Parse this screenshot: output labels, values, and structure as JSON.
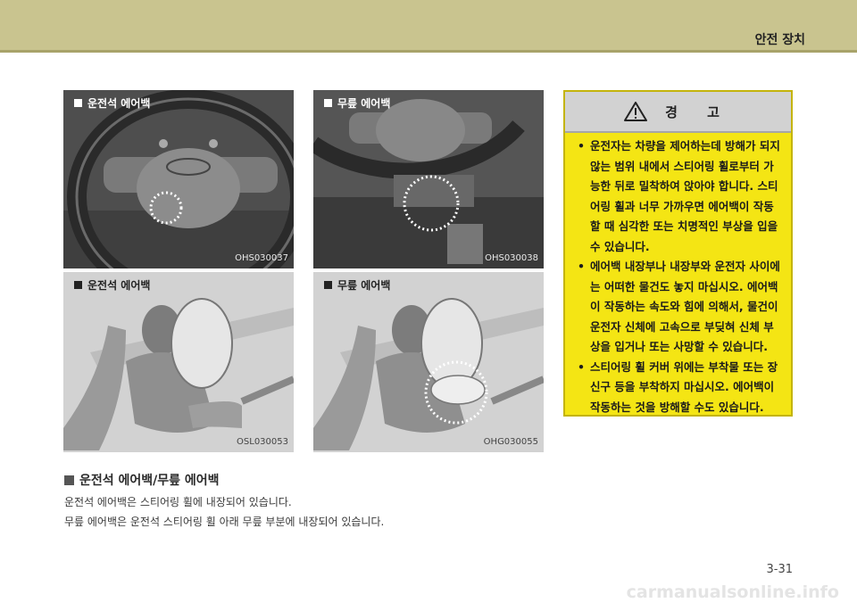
{
  "header": {
    "title": "안전 장치"
  },
  "figures": [
    {
      "caption": "운전석 에어백",
      "code": "OHS030037"
    },
    {
      "caption": "무릎 에어백",
      "code": "OHS030038"
    },
    {
      "caption": "운전석 에어백",
      "code": "OSL030053"
    },
    {
      "caption": "무릎 에어백",
      "code": "OHG030055"
    }
  ],
  "warning": {
    "title": "경 고",
    "items": [
      "운전자는 차량을 제어하는데 방해가 되지 않는 범위 내에서 스티어링 휠로부터 가능한 뒤로 밀착하여 앉아야 합니다. 스티어링 휠과 너무 가까우면 에어백이 작동할 때 심각한 또는 치명적인 부상을 입을 수 있습니다.",
      "에어백 내장부나 내장부와 운전자 사이에는 어떠한 물건도 놓지 마십시오. 에어백이 작동하는 속도와 힘에 의해서, 물건이 운전자 신체에 고속으로 부딪혀 신체 부상을 입거나 또는 사망할 수 있습니다.",
      "스티어링 휠 커버 위에는 부착물 또는 장신구 등을 부착하지 마십시오. 에어백이 작동하는 것을 방해할 수도 있습니다."
    ]
  },
  "section": {
    "heading": "운전석 에어백/무릎 에어백",
    "lines": [
      "운전석 에어백은 스티어링 휠에 내장되어 있습니다.",
      "무릎 에어백은 운전석 스티어링 휠 아래 무릎 부분에 내장되어 있습니다."
    ]
  },
  "page_number": "3-31",
  "watermark": "carmanualsonline.info",
  "colors": {
    "header_band": "#c9c48f",
    "warning_bg": "#f4e514",
    "warning_head": "#d2d2d2"
  }
}
